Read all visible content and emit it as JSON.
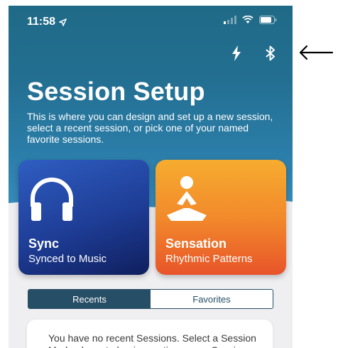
{
  "status_bar": {
    "time": "11:58"
  },
  "header": {
    "title": "Session Setup",
    "subtitle": "This is where you can design and set up a new session, select a recent session, or pick one of your named favorite sessions."
  },
  "cards": [
    {
      "title": "Sync",
      "subtitle": "Synced to Music",
      "icon": "headphones-icon",
      "color": "#2a55b5"
    },
    {
      "title": "Sensation",
      "subtitle": "Rhythmic Patterns",
      "icon": "meditation-icon",
      "color": "#f29a2e"
    }
  ],
  "tabs": {
    "recents": "Recents",
    "favorites": "Favorites"
  },
  "empty_state": {
    "text": "You have no recent Sessions. Select a Session Mode above to begin creating a new Session."
  },
  "colors": {
    "accent": "#264e66",
    "header": "#236f92"
  }
}
